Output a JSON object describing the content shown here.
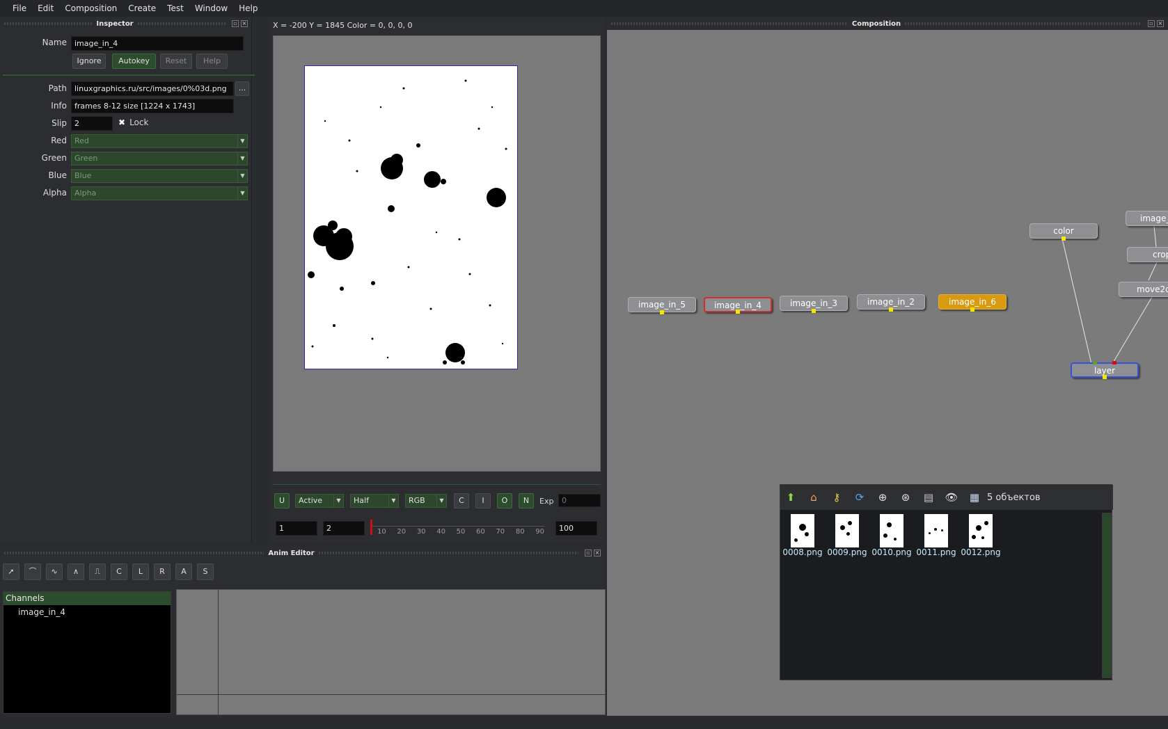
{
  "menu": [
    "File",
    "Edit",
    "Composition",
    "Create",
    "Test",
    "Window",
    "Help"
  ],
  "inspector": {
    "title": "Inspector",
    "name_label": "Name",
    "name_value": "image_in_4",
    "buttons": {
      "ignore": "Ignore",
      "autokey": "Autokey",
      "reset": "Reset",
      "help": "Help"
    },
    "path_label": "Path",
    "path_value": "linuxgraphics.ru/src/images/0%03d.png",
    "browse": "...",
    "info_label": "Info",
    "info_value": "frames 8-12 size [1224 x 1743]",
    "slip_label": "Slip",
    "slip_value": "2",
    "lock_label": "Lock",
    "lock_icon": "✖",
    "channels": [
      {
        "label": "Red",
        "value": "Red"
      },
      {
        "label": "Green",
        "value": "Green"
      },
      {
        "label": "Blue",
        "value": "Blue"
      },
      {
        "label": "Alpha",
        "value": "Alpha"
      }
    ]
  },
  "viewer": {
    "status": "X = -200 Y = 1845 Color = 0, 0, 0, 0",
    "controls": {
      "u": "U",
      "mode": "Active",
      "resolution": "Half",
      "channels": "RGB",
      "c": "C",
      "i": "I",
      "o": "O",
      "n": "N",
      "exp_label": "Exp",
      "exp_value": "0"
    },
    "timeline": {
      "start": "1",
      "current": "2",
      "end": "100",
      "ticks": [
        "10",
        "20",
        "30",
        "40",
        "50",
        "60",
        "70",
        "80",
        "90"
      ]
    }
  },
  "composition": {
    "title": "Composition",
    "nodes": {
      "image_in_5": "image_in_5",
      "image_in_4": "image_in_4",
      "image_in_3": "image_in_3",
      "image_in_2": "image_in_2",
      "image_in_6": "image_in_6",
      "color": "color",
      "image_top": "image_",
      "crop": "crop",
      "move2d": "move2d",
      "layer": "layer"
    }
  },
  "file_browser": {
    "count": "5 объектов",
    "files": [
      "0008.png",
      "0009.png",
      "0010.png",
      "0011.png",
      "0012.png"
    ]
  },
  "anim_editor": {
    "title": "Anim Editor",
    "tools": {
      "c": "C",
      "l": "L",
      "r": "R",
      "a": "A",
      "s": "S"
    },
    "channels_header": "Channels",
    "channels": [
      "image_in_4"
    ]
  },
  "colors": {
    "accent_green": "#2d4b2d",
    "selected_node_border": "#d03030",
    "highlight_node": "#d79a10",
    "layer_border": "#3a50d8"
  }
}
